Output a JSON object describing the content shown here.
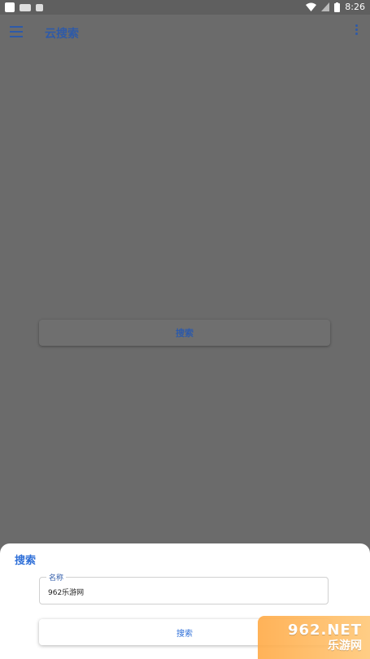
{
  "status_bar": {
    "time": "8:26"
  },
  "app_bar": {
    "title": "云搜索"
  },
  "background": {
    "search_button_label": "搜索"
  },
  "sheet": {
    "title": "搜索",
    "field": {
      "label": "名称",
      "value": "962乐游网"
    },
    "button_label": "搜索"
  },
  "watermark": {
    "top": "962.NET",
    "bottom": "乐游网"
  },
  "colors": {
    "accent": "#2e6fd8",
    "scrim": "#6b6b6b",
    "sheet": "#ffffff"
  }
}
